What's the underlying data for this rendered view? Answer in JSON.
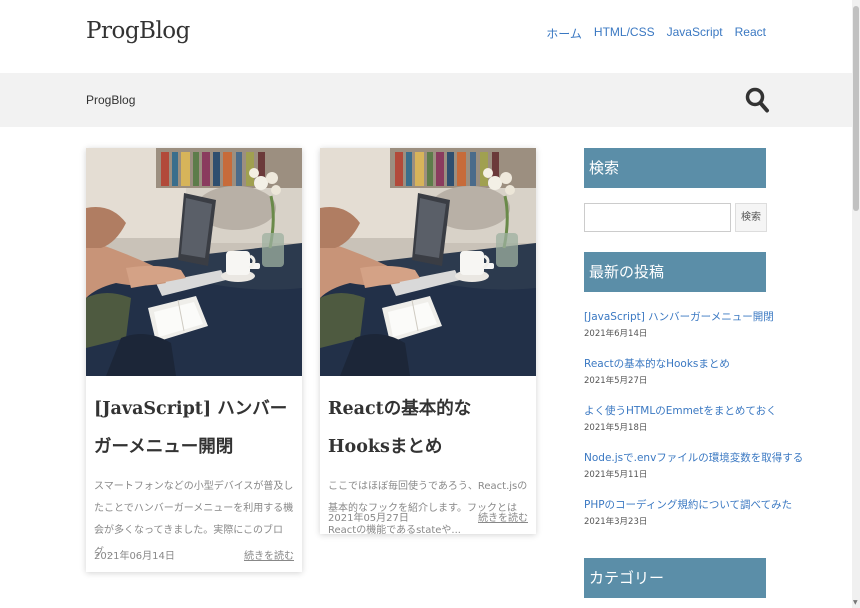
{
  "header": {
    "logo": "ProgBlog",
    "nav": [
      "ホーム",
      "HTML/CSS",
      "JavaScript",
      "React"
    ]
  },
  "breadcrumb": {
    "label": "ProgBlog",
    "search_icon": "search-icon"
  },
  "posts": [
    {
      "title": "[JavaScript] ハンバーガーメニュー開閉",
      "excerpt": "スマートフォンなどの小型デバイスが普及したことでハンバーガーメニューを利用する機会が多くなってきました。実際にこのブログ...",
      "date": "2021年06月14日",
      "more": "続きを読む"
    },
    {
      "title": "Reactの基本的なHooksまとめ",
      "excerpt": "ここではほぼ毎回使うであろう、React.jsの基本的なフックを紹介します。フックとはReactの機能であるstateや...",
      "date": "2021年05月27日",
      "more": "続きを読む"
    }
  ],
  "sidebar": {
    "search": {
      "heading": "検索",
      "placeholder": "",
      "button": "検索"
    },
    "recent": {
      "heading": "最新の投稿",
      "items": [
        {
          "title": "[JavaScript] ハンバーガーメニュー開閉",
          "date": "2021年6月14日"
        },
        {
          "title": "Reactの基本的なHooksまとめ",
          "date": "2021年5月27日"
        },
        {
          "title": "よく使うHTMLのEmmetをまとめておく",
          "date": "2021年5月18日"
        },
        {
          "title": "Node.jsで.envファイルの環境変数を取得する",
          "date": "2021年5月11日"
        },
        {
          "title": "PHPのコーディング規約について調べてみた",
          "date": "2021年3月23日"
        }
      ]
    },
    "category": {
      "heading": "カテゴリー"
    }
  },
  "colors": {
    "accent": "#5b8ea8",
    "link": "#3a78c2",
    "crumb_bg": "#f2f2f2"
  }
}
